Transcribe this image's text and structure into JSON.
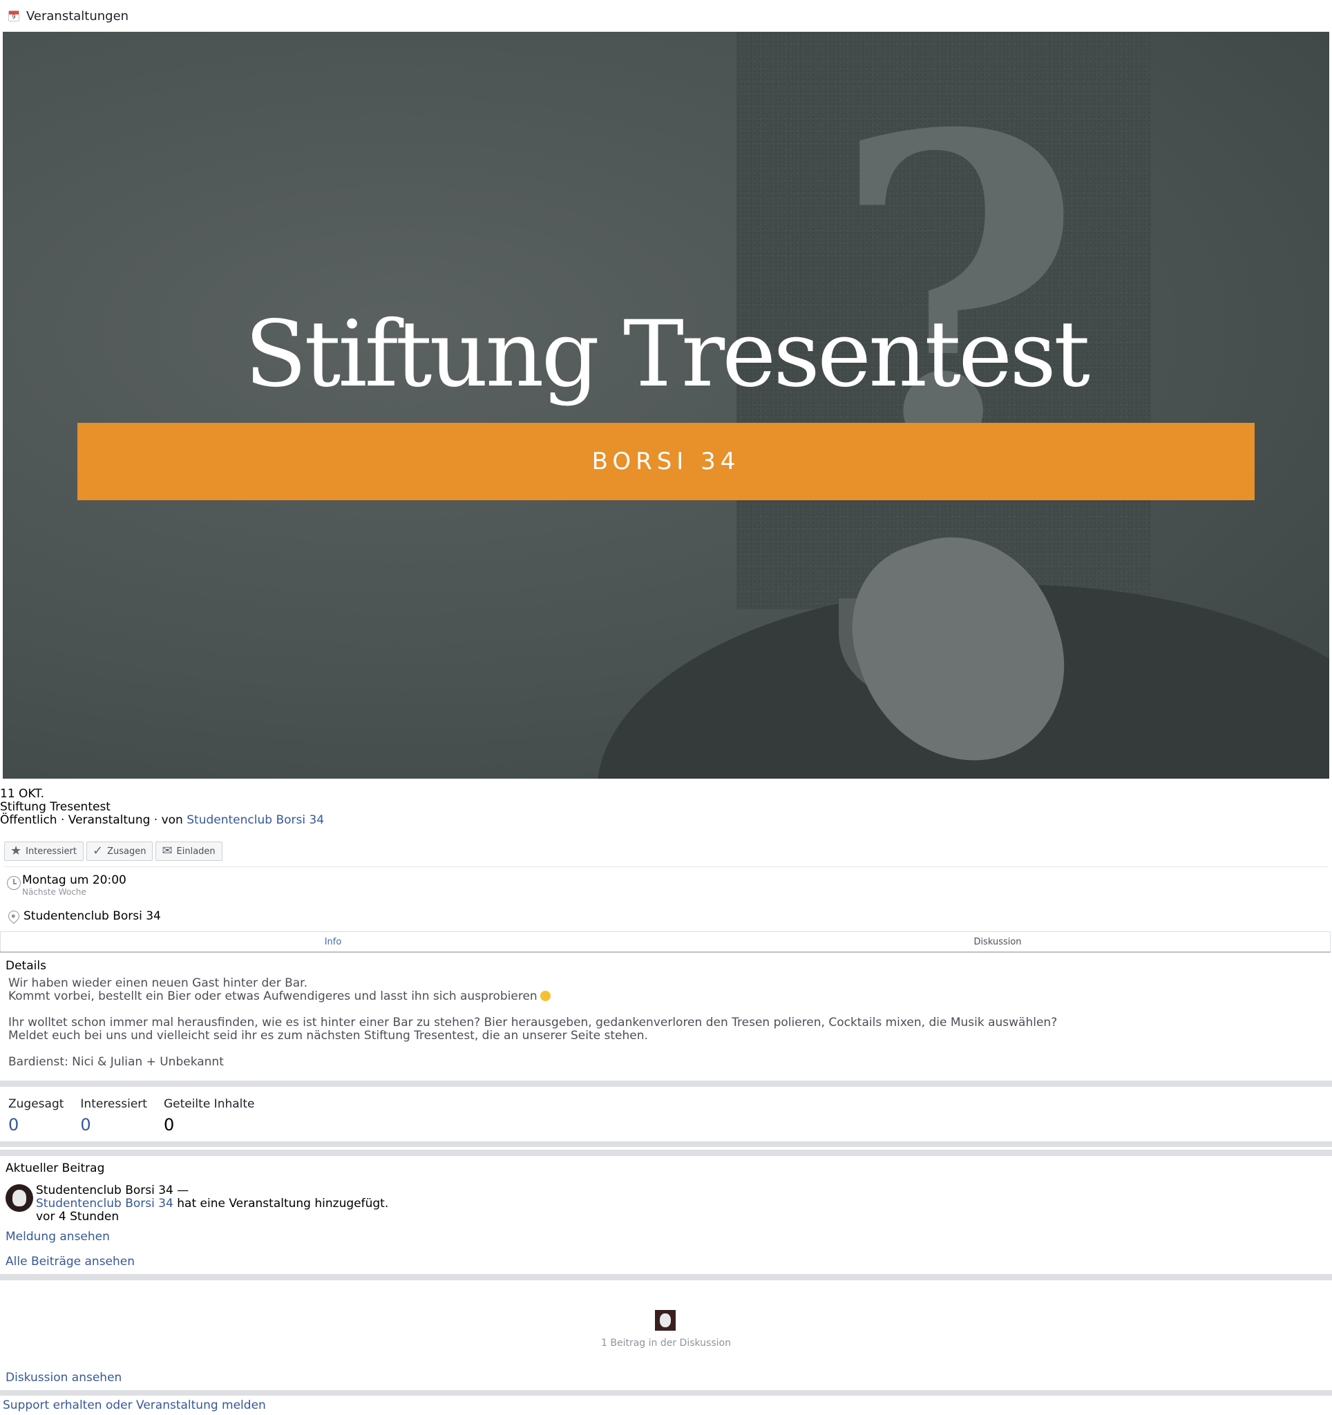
{
  "header": {
    "title": "Veranstaltungen",
    "icon": "calendar-icon"
  },
  "cover": {
    "title": "Stiftung Tresentest",
    "banner": "BORSI 34",
    "banner_color": "#e8902a"
  },
  "event": {
    "date": "11 OKT.",
    "name": "Stiftung Tresentest",
    "meta_prefix": "Öffentlich · Veranstaltung · von ",
    "host": "Studentenclub Borsi 34"
  },
  "actions": {
    "interested": "Interessiert",
    "going": "Zusagen",
    "invite": "Einladen"
  },
  "when": {
    "time": "Montag um 20:00",
    "relative": "Nächste Woche"
  },
  "where": {
    "place": "Studentenclub Borsi 34"
  },
  "tabs": [
    {
      "label": "Info",
      "active": true
    },
    {
      "label": "Diskussion",
      "active": false
    }
  ],
  "details": {
    "title": "Details",
    "lines": [
      "Wir haben wieder einen neuen Gast hinter der Bar.",
      "Kommt vorbei, bestellt ein Bier oder etwas Aufwendigeres und lasst ihn sich ausprobieren",
      "Ihr wolltet schon immer mal herausfinden, wie es ist hinter einer Bar zu stehen? Bier herausgeben, gedankenverloren den Tresen polieren, Cocktails mixen, die Musik auswählen?",
      "Meldet euch bei uns und vielleicht seid ihr es zum nächsten Stiftung Tresentest, die an unserer Seite stehen.",
      "Bardienst: Nici & Julian + Unbekannt"
    ]
  },
  "stats": {
    "going_label": "Zugesagt",
    "going_value": "0",
    "interested_label": "Interessiert",
    "interested_value": "0",
    "shares_label": "Geteilte Inhalte",
    "shares_value": "0"
  },
  "recent": {
    "title": "Aktueller Beitrag",
    "author_line": "Studentenclub Borsi 34 —",
    "author_link": "Studentenclub Borsi 34",
    "action_text": " hat eine Veranstaltung hinzugefügt.",
    "time": "vor 4 Stunden",
    "view_post": "Meldung ansehen",
    "view_all": "Alle Beiträge ansehen"
  },
  "discussion": {
    "count_text": "1 Beitrag in der Diskussion",
    "view": "Diskussion ansehen"
  },
  "footer": {
    "support": "Support erhalten oder Veranstaltung melden"
  }
}
